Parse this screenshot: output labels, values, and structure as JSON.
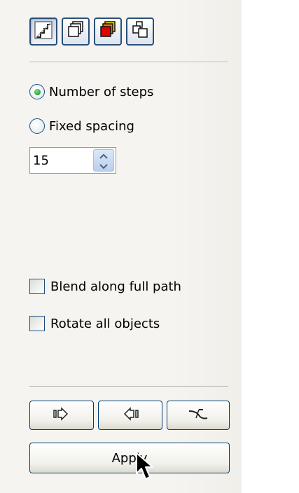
{
  "mode_buttons": [
    {
      "name": "steps-mode",
      "icon": "blend-steps-icon",
      "pressed": true
    },
    {
      "name": "direct-mode",
      "icon": "blend-direct-icon",
      "pressed": false
    },
    {
      "name": "clockwise-mode",
      "icon": "blend-colors-icon",
      "pressed": false
    },
    {
      "name": "counter-mode",
      "icon": "blend-objects-icon",
      "pressed": false
    }
  ],
  "options": {
    "number_of_steps_label": "Number of steps",
    "number_of_steps_selected": true,
    "fixed_spacing_label": "Fixed spacing",
    "fixed_spacing_selected": false,
    "steps_value": "15"
  },
  "checks": {
    "blend_full_path_label": "Blend along full path",
    "blend_full_path_checked": false,
    "rotate_all_label": "Rotate all objects",
    "rotate_all_checked": false
  },
  "nav_buttons": [
    {
      "name": "start-object",
      "icon": "start-object-icon"
    },
    {
      "name": "end-object",
      "icon": "end-object-icon"
    },
    {
      "name": "path-properties",
      "icon": "path-properties-icon"
    }
  ],
  "apply_label": "Apply",
  "colors": {
    "border_blue": "#003c74",
    "radio_green": "#20a435",
    "panel_bg": "#f5f4f0"
  }
}
